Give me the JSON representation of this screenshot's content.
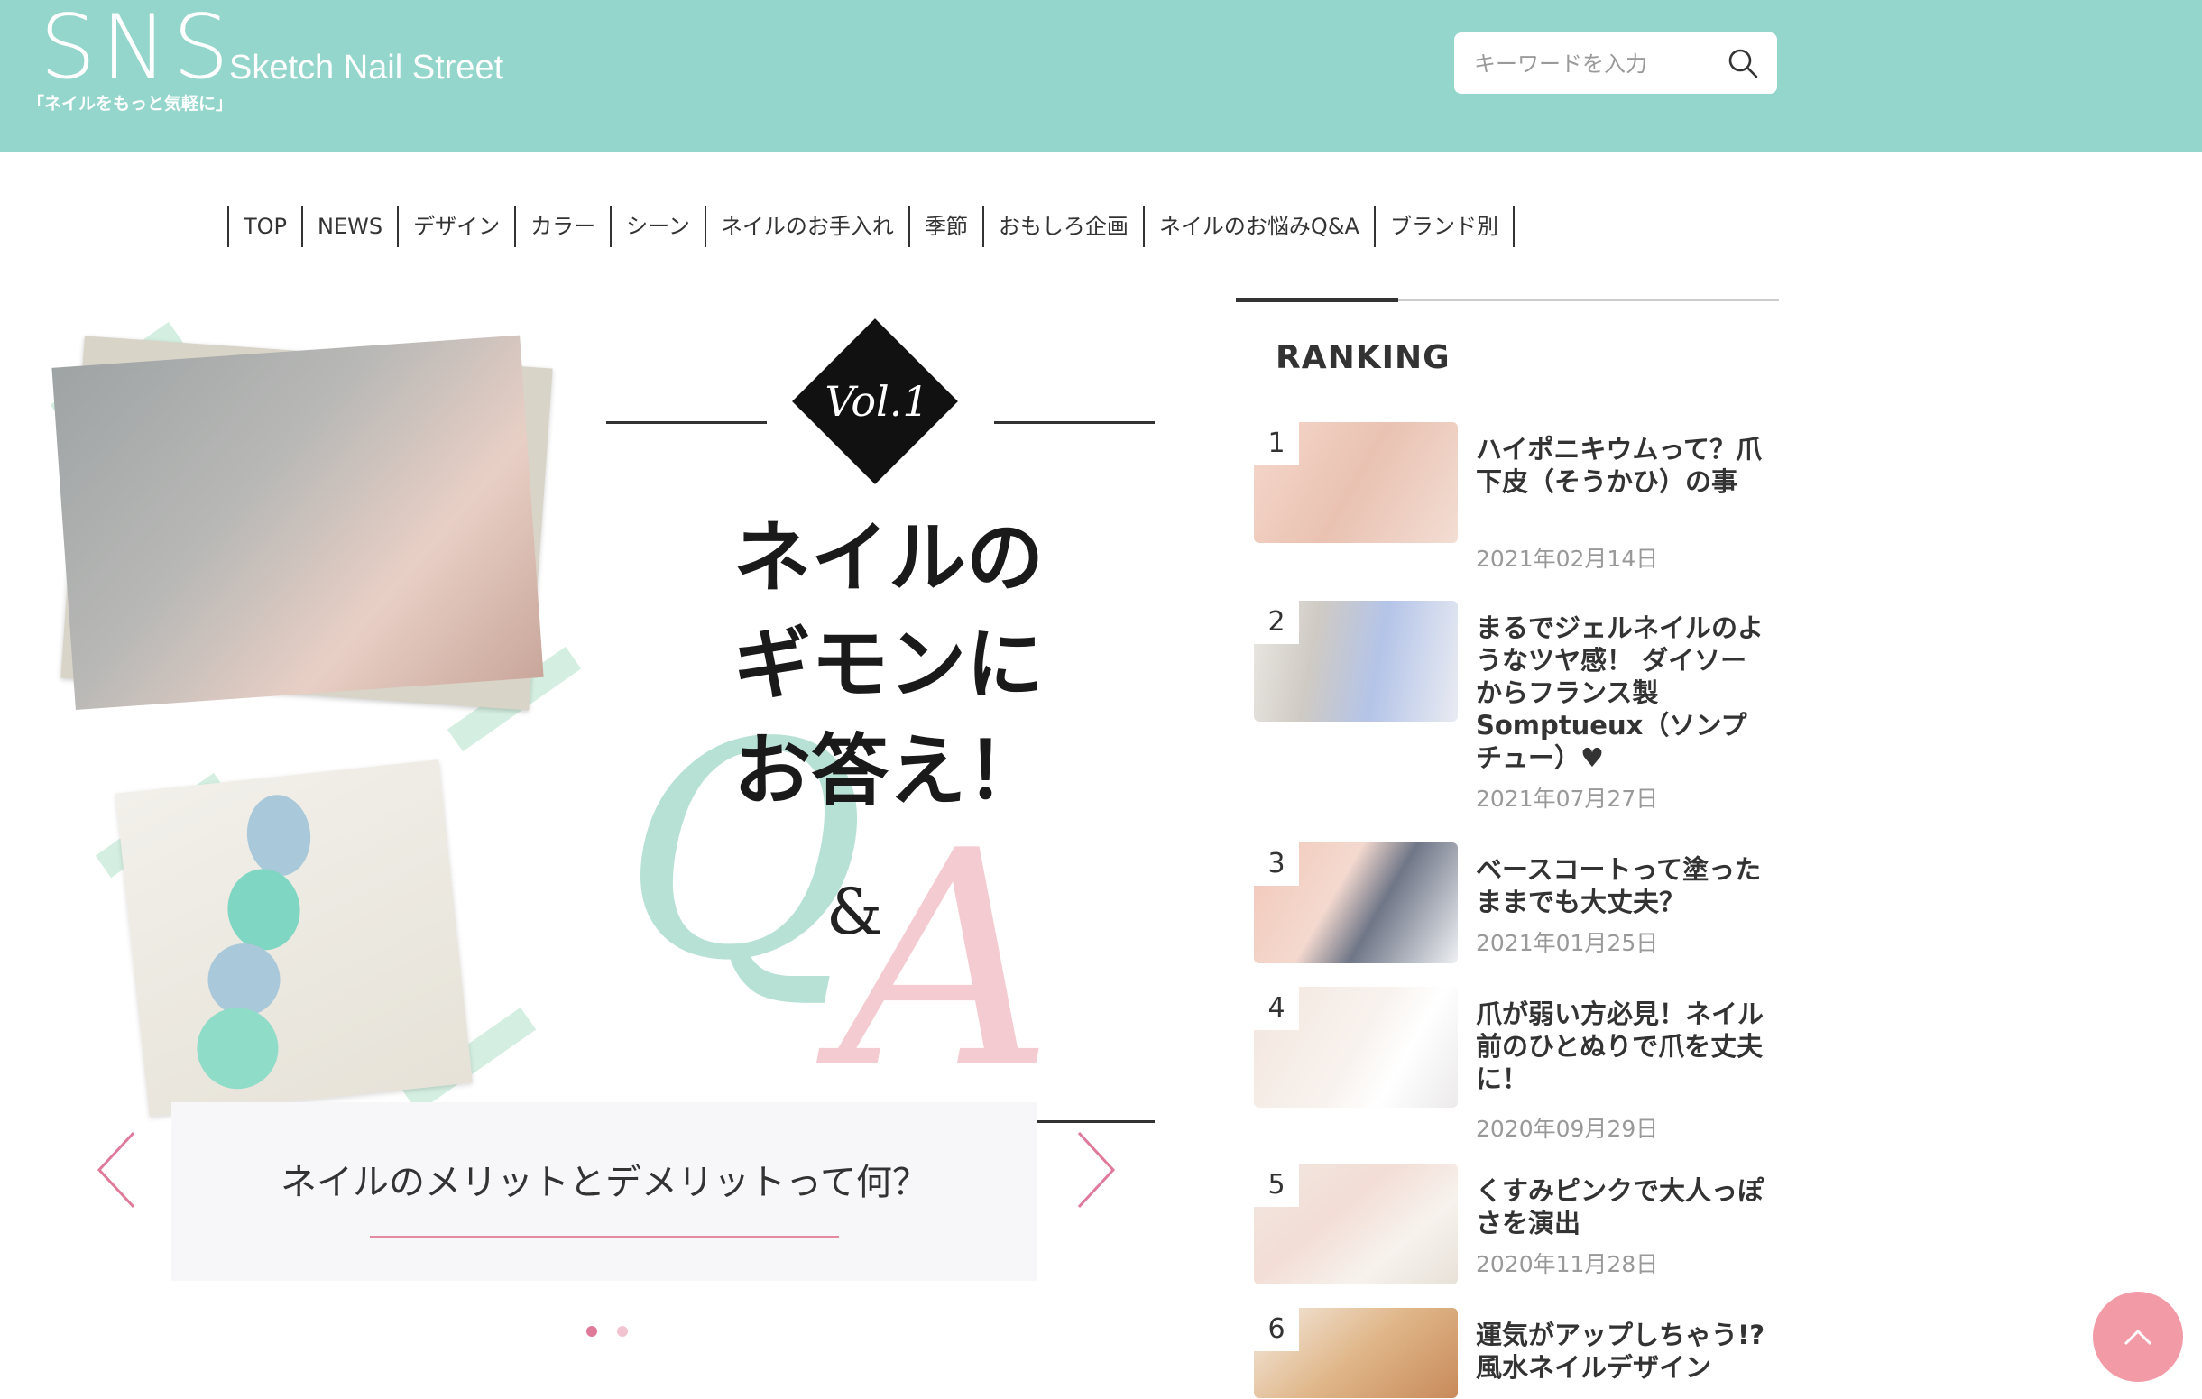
{
  "header": {
    "logo_mark": "SNS",
    "logo_name": "Sketch Nail Street",
    "tagline": "「ネイルをもっと気軽に」",
    "search_placeholder": "キーワードを入力"
  },
  "nav": {
    "items": [
      "TOP",
      "NEWS",
      "デザイン",
      "カラー",
      "シーン",
      "ネイルのお手入れ",
      "季節",
      "おもしろ企画",
      "ネイルのお悩みQ&A",
      "ブランド別"
    ]
  },
  "hero": {
    "vol": "Vol.1",
    "title_line1": "ネイルの",
    "title_line2": "ギモンに",
    "title_line3": "お答え！",
    "q_letter": "Q",
    "amp": "&",
    "a_letter": "A",
    "caption": "ネイルのメリットとデメリットって何？",
    "slide_count": 2,
    "active_slide": 1
  },
  "ranking": {
    "title": "RANKING",
    "items": [
      {
        "rank": "1",
        "title": "ハイポニキウムって？爪下皮（そうかひ）の事",
        "date": "2021年02月14日"
      },
      {
        "rank": "2",
        "title": "まるでジェルネイルのようなツヤ感！ ダイソーからフランス製Somptueux（ソンプチュー）♥",
        "date": "2021年07月27日"
      },
      {
        "rank": "3",
        "title": "ベースコートって塗ったままでも大丈夫？",
        "date": "2021年01月25日"
      },
      {
        "rank": "4",
        "title": "爪が弱い方必見！ネイル前のひとぬりで爪を丈夫に！",
        "date": "2020年09月29日"
      },
      {
        "rank": "5",
        "title": "くすみピンクで大人っぽさを演出",
        "date": "2020年11月28日"
      },
      {
        "rank": "6",
        "title": "運気がアップしちゃう!?風水ネイルデザイン",
        "date": ""
      }
    ]
  },
  "colors": {
    "header_bg": "#94d6cb",
    "accent_pink": "#e07a9b",
    "to_top_bg": "#f29aa6"
  }
}
